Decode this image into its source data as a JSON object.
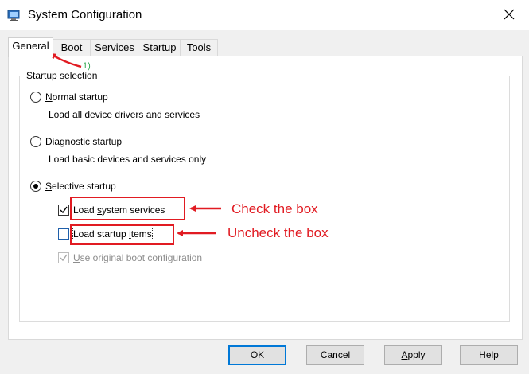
{
  "window": {
    "title": "System Configuration",
    "close_glyph": "✕"
  },
  "tabs": [
    {
      "label": "General",
      "active": true
    },
    {
      "label": "Boot",
      "active": false
    },
    {
      "label": "Services",
      "active": false
    },
    {
      "label": "Startup",
      "active": false
    },
    {
      "label": "Tools",
      "active": false
    }
  ],
  "startup_selection": {
    "group_label": "Startup selection",
    "normal": {
      "label_first": "N",
      "label_rest": "ormal startup",
      "description": "Load all device drivers and services",
      "selected": false
    },
    "diagnostic": {
      "label_first": "D",
      "label_rest": "iagnostic startup",
      "description": "Load basic devices and services only",
      "selected": false
    },
    "selective": {
      "label_first": "S",
      "label_rest": "elective startup",
      "selected": true
    },
    "options": {
      "load_system_services": {
        "label_pre": "Load ",
        "label_ul": "s",
        "label_post": "ystem services",
        "checked": true
      },
      "load_startup_items": {
        "label_pre": "Load startup ",
        "label_ul": "i",
        "label_post": "tems",
        "checked": false
      },
      "use_original_boot": {
        "label_ul": "U",
        "label_post": "se original boot configuration",
        "checked": true,
        "disabled": true
      }
    }
  },
  "annotations": {
    "step_1": "1)",
    "check_text": "Check the box",
    "uncheck_text": "Uncheck the box",
    "color": "#e11b22",
    "step_color": "#34a853"
  },
  "buttons": {
    "ok": "OK",
    "cancel": "Cancel",
    "apply_ul": "A",
    "apply_rest": "pply",
    "help": "Help"
  },
  "icons": {
    "title": "system-config-icon",
    "close": "close-icon"
  }
}
